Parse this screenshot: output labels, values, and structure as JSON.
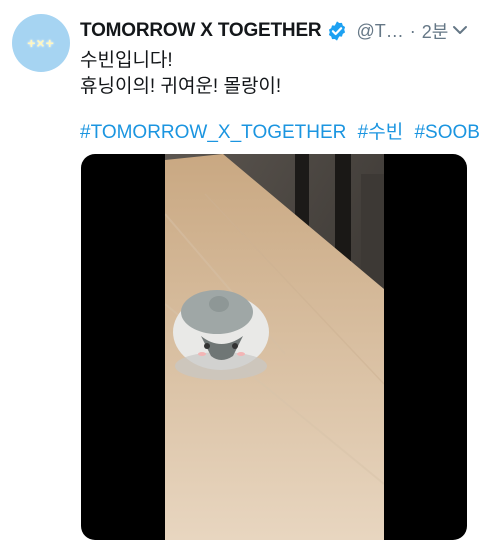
{
  "tweet": {
    "display_name": "TOMORROW X TOGETHER",
    "handle": "@T…",
    "separator": "·",
    "time": "2분",
    "avatar_logo": "+×+",
    "text_lines": [
      "수빈입니다!",
      "휴닝이의! 귀여운! 몰랑이!"
    ],
    "hashtags": [
      "#TOMORROW_X_TOGETHER",
      "#수빈",
      "#SOOBIN"
    ]
  },
  "icons": {
    "verified": "verified-badge-icon",
    "menu": "chevron-down-icon"
  },
  "colors": {
    "link": "#1b95e0",
    "verified": "#1da1f2",
    "avatar_bg": "#a6d4f2",
    "muted": "#657786",
    "text": "#14171a"
  }
}
